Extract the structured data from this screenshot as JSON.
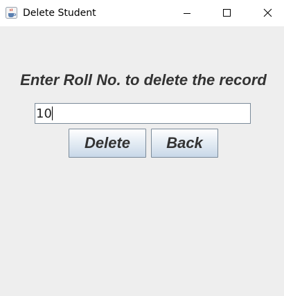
{
  "window": {
    "title": "Delete Student",
    "icon": "java-coffee-cup-icon",
    "controls": {
      "minimize": "minimize-icon",
      "maximize": "maximize-icon",
      "close": "close-icon"
    }
  },
  "form": {
    "heading": "Enter Roll No. to delete the record",
    "roll_no_value": "10",
    "delete_label": "Delete",
    "back_label": "Back"
  },
  "colors": {
    "background": "#eeeeee",
    "text": "#333333",
    "button_top": "#ffffff",
    "button_bottom": "#c8d8e8",
    "border": "#7a8a99"
  }
}
